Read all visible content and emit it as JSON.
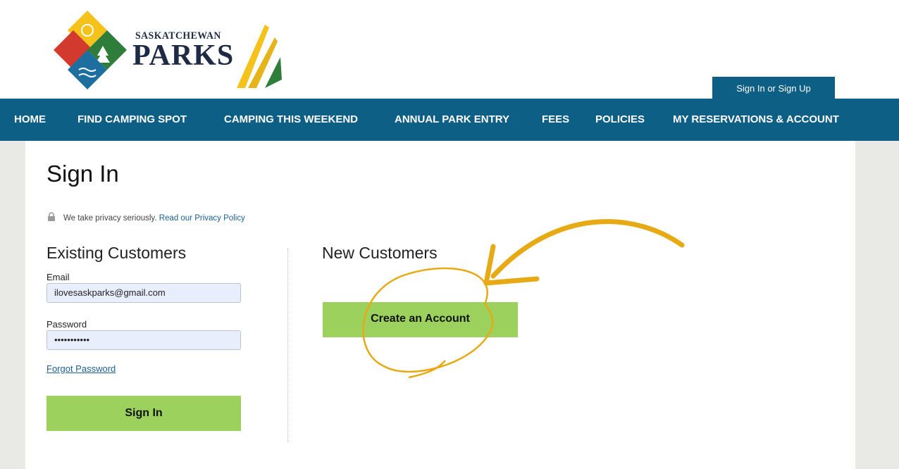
{
  "header": {
    "brand_top": "SASKATCHEWAN",
    "brand_main": "PARKS",
    "sign_in_tab": "Sign In or Sign Up"
  },
  "nav": {
    "items": [
      {
        "label": "HOME"
      },
      {
        "label": "FIND CAMPING SPOT"
      },
      {
        "label": "CAMPING THIS WEEKEND"
      },
      {
        "label": "ANNUAL PARK ENTRY"
      },
      {
        "label": "FEES"
      },
      {
        "label": "POLICIES"
      },
      {
        "label": "MY RESERVATIONS & ACCOUNT"
      }
    ]
  },
  "page": {
    "title": "Sign In",
    "privacy_text": "We take privacy seriously.",
    "privacy_link": "Read our Privacy Policy"
  },
  "existing": {
    "heading": "Existing Customers",
    "email_label": "Email",
    "email_value": "ilovesaskparks@gmail.com",
    "password_label": "Password",
    "password_value": "•••••••••••",
    "forgot_label": "Forgot Password",
    "sign_in_button": "Sign In"
  },
  "new_customers": {
    "heading": "New Customers",
    "create_button": "Create an Account"
  },
  "colors": {
    "nav_blue": "#0d5f86",
    "button_green": "#9bd15c",
    "annotation_gold": "#e8aa14"
  }
}
